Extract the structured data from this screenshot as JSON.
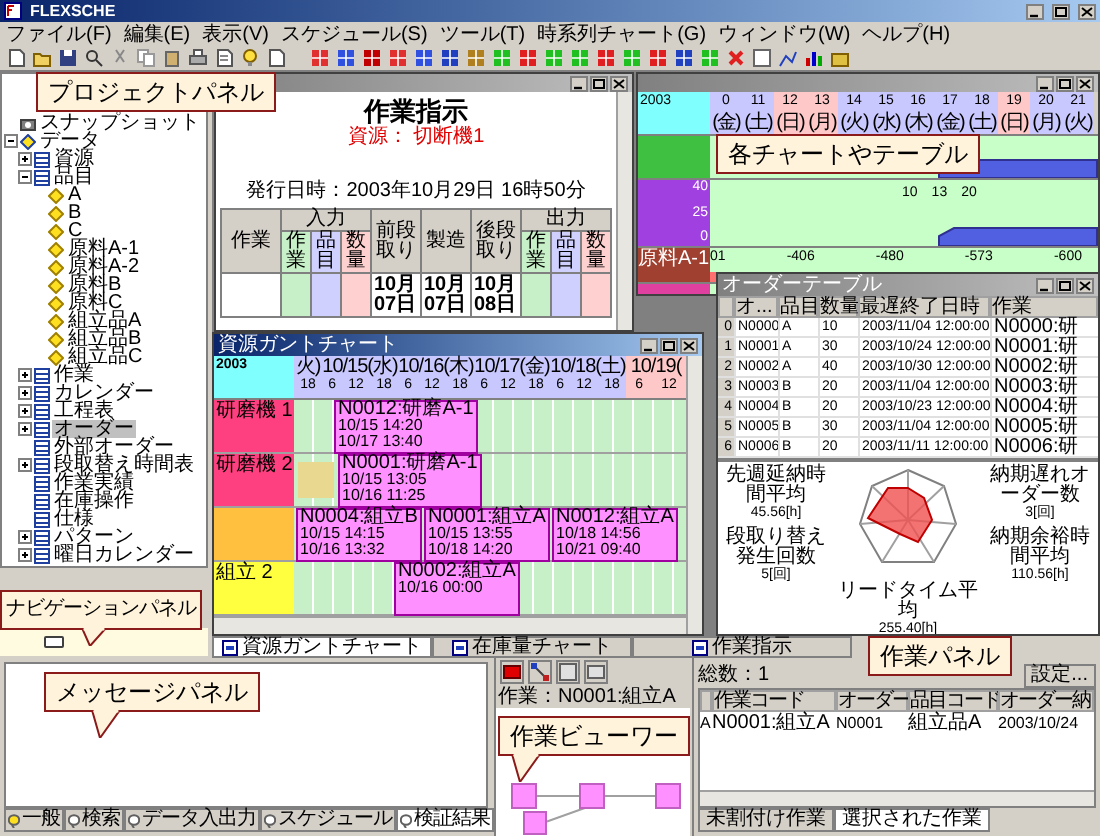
{
  "window": {
    "title": "FLEXSCHE"
  },
  "menu": [
    "ファイル(F)",
    "編集(E)",
    "表示(V)",
    "スケジュール(S)",
    "ツール(T)",
    "時系列チャート(G)",
    "ウィンドウ(W)",
    "ヘルプ(H)"
  ],
  "project_tree": [
    {
      "label": "スナップショット",
      "kind": "snapshot",
      "selected": false
    },
    {
      "label": "データ",
      "kind": "folder",
      "expanded": true,
      "selected": false,
      "children": [
        {
          "label": "資源",
          "kind": "table",
          "expanded": false,
          "selected": false
        },
        {
          "label": "品目",
          "kind": "table",
          "expanded": true,
          "selected": false,
          "children": [
            {
              "label": "A",
              "kind": "item",
              "selected": false
            },
            {
              "label": "B",
              "kind": "item",
              "selected": false
            },
            {
              "label": "C",
              "kind": "item",
              "selected": false
            },
            {
              "label": "原料A-1",
              "kind": "item",
              "selected": false
            },
            {
              "label": "原料A-2",
              "kind": "item",
              "selected": false
            },
            {
              "label": "原料B",
              "kind": "item",
              "selected": false
            },
            {
              "label": "原料C",
              "kind": "item",
              "selected": false
            },
            {
              "label": "組立品A",
              "kind": "item",
              "selected": false
            },
            {
              "label": "組立品B",
              "kind": "item",
              "selected": false
            },
            {
              "label": "組立品C",
              "kind": "item",
              "selected": false
            }
          ]
        },
        {
          "label": "作業",
          "kind": "table",
          "expanded": false,
          "selected": false
        },
        {
          "label": "カレンダー",
          "kind": "table",
          "expanded": false,
          "selected": false
        },
        {
          "label": "工程表",
          "kind": "table",
          "expanded": false,
          "selected": false
        },
        {
          "label": "オーダー",
          "kind": "table",
          "expanded": false,
          "selected": true
        },
        {
          "label": "外部オーダー",
          "kind": "table",
          "selected": false
        },
        {
          "label": "段取替え時間表",
          "kind": "table",
          "expanded": false,
          "selected": false
        },
        {
          "label": "作業実績",
          "kind": "table",
          "selected": false
        },
        {
          "label": "在庫操作",
          "kind": "table",
          "selected": false
        },
        {
          "label": "仕様",
          "kind": "table",
          "selected": false
        },
        {
          "label": "パターン",
          "kind": "table",
          "expanded": false,
          "selected": false
        },
        {
          "label": "曜日カレンダー",
          "kind": "table",
          "expanded": false,
          "selected": false
        }
      ]
    }
  ],
  "callouts": [
    {
      "text": "プロジェクトパネル"
    },
    {
      "text": "各チャートやテーブル"
    },
    {
      "text": "ナビゲーションパネル"
    },
    {
      "text": "メッセージパネル"
    },
    {
      "text": "作業ビューワー"
    },
    {
      "text": "作業パネル"
    }
  ],
  "work_instruction": {
    "heading": "作業指示",
    "resource": "資源： 切断機1",
    "issued": "発行日時：2003年10月29日 16時50分",
    "columns": [
      {
        "label": "作業"
      },
      {
        "label": "入力",
        "sub": [
          {
            "label": "作業",
            "color": "#c8f0c8"
          },
          {
            "label": "品目",
            "color": "#d0d0ff"
          },
          {
            "label": "数量",
            "color": "#ffd0d0"
          }
        ]
      },
      {
        "label": "前段取り"
      },
      {
        "label": "製造"
      },
      {
        "label": "後段取り"
      },
      {
        "label": "出力",
        "sub": [
          {
            "label": "作業",
            "color": "#c8f0c8"
          },
          {
            "label": "品目",
            "color": "#d0d0ff"
          },
          {
            "label": "数量",
            "color": "#ffd0d0"
          }
        ]
      }
    ],
    "dates": [
      "10月07日",
      "10月07日",
      "10月08日"
    ]
  },
  "inventory_chart": {
    "year": "2003",
    "dates": [
      {
        "day": "0",
        "weekday": "(金)",
        "color": "#c8c8ff"
      },
      {
        "day": "11",
        "weekday": "(土)",
        "color": "#c8c8ff"
      },
      {
        "day": "12",
        "weekday": "(日)",
        "color": "#ffc8c8"
      },
      {
        "day": "13",
        "weekday": "(月)",
        "color": "#ffc8c8"
      },
      {
        "day": "14",
        "weekday": "(火)",
        "color": "#c8c8ff"
      },
      {
        "day": "15",
        "weekday": "(水)",
        "color": "#c8c8ff"
      },
      {
        "day": "16",
        "weekday": "(木)",
        "color": "#c8c8ff"
      },
      {
        "day": "17",
        "weekday": "(金)",
        "color": "#c8c8ff"
      },
      {
        "day": "18",
        "weekday": "(土)",
        "color": "#c8c8ff"
      },
      {
        "day": "19",
        "weekday": "(日)",
        "color": "#ffc8c8"
      },
      {
        "day": "20",
        "weekday": "(月)",
        "color": "#c8c8ff"
      },
      {
        "day": "21",
        "weekday": "(火)",
        "color": "#c8c8ff"
      }
    ],
    "rows": [
      {
        "kind": "area",
        "color": "#40c040"
      },
      {
        "kind": "area",
        "color": "#a040e0",
        "axis_labels": [
          "40",
          "25",
          "0"
        ],
        "markers": [
          "10",
          "13",
          "20"
        ]
      },
      {
        "kind": "bar",
        "color": "#a04030",
        "label": "原料A-1",
        "values": [
          "01",
          "-406",
          "-480",
          "-573",
          "-600"
        ]
      },
      {
        "kind": "strip",
        "color": "#e040a0"
      }
    ]
  },
  "order_table": {
    "title": "オーダーテーブル",
    "columns": [
      "オ...",
      "品目",
      "数量",
      "最遅終了日時",
      "作業"
    ],
    "rows": [
      {
        "index": "0",
        "cells": [
          "N0000",
          "A",
          "10",
          "2003/11/04 12:00:00",
          "N0000:研"
        ]
      },
      {
        "index": "1",
        "cells": [
          "N0001",
          "A",
          "30",
          "2003/10/24 12:00:00",
          "N0001:研"
        ]
      },
      {
        "index": "2",
        "cells": [
          "N0002",
          "A",
          "40",
          "2003/10/30 12:00:00",
          "N0002:研"
        ]
      },
      {
        "index": "3",
        "cells": [
          "N0003",
          "B",
          "20",
          "2003/11/04 12:00:00",
          "N0003:研"
        ]
      },
      {
        "index": "4",
        "cells": [
          "N0004",
          "B",
          "20",
          "2003/10/23 12:00:00",
          "N0004:研"
        ]
      },
      {
        "index": "5",
        "cells": [
          "N0005",
          "B",
          "30",
          "2003/11/04 12:00:00",
          "N0005:研"
        ]
      },
      {
        "index": "6",
        "cells": [
          "N0006",
          "B",
          "20",
          "2003/11/11 12:00:00",
          "N0006:研"
        ]
      }
    ]
  },
  "performance_radar": {
    "metrics": [
      {
        "label": "先週延納時間平均",
        "value": "45.56[h]"
      },
      {
        "label": "納期遅れオーダー数",
        "value": "3[回]"
      },
      {
        "label": "段取り替え発生回数",
        "value": "5[回]"
      },
      {
        "label": "納期余裕時間平均",
        "value": "110.56[h]"
      },
      {
        "label": "リードタイム平均",
        "value": "255.40[h]"
      }
    ]
  },
  "gantt": {
    "title": "資源ガントチャート",
    "year": "2003",
    "days": [
      {
        "label": "火)",
        "hours": [
          "18"
        ],
        "color": "#c8c8ff"
      },
      {
        "label": "10/15(水)",
        "hours": [
          "6",
          "12",
          "18"
        ],
        "color": "#c8c8ff"
      },
      {
        "label": "10/16(木)",
        "hours": [
          "6",
          "12",
          "18"
        ],
        "color": "#c8c8ff"
      },
      {
        "label": "10/17(金)",
        "hours": [
          "6",
          "12",
          "18"
        ],
        "color": "#c8c8ff"
      },
      {
        "label": "10/18(土)",
        "hours": [
          "6",
          "12",
          "18"
        ],
        "color": "#c8c8ff"
      },
      {
        "label": "10/19(",
        "hours": [
          "6",
          "12"
        ],
        "color": "#ffc8c8"
      }
    ],
    "rows": [
      {
        "label": "研磨機 1",
        "color": "#ff4080",
        "bars": [
          {
            "lines": [
              "N0012:研磨A-1",
              "10/15 14:20",
              "10/17 13:40"
            ]
          }
        ]
      },
      {
        "label": "研磨機 2",
        "color": "#ff4080",
        "bars": [
          {
            "lines": [
              "N0001:研磨A-1",
              "10/15 13:05",
              "10/16 11:25"
            ]
          }
        ]
      },
      {
        "color": "#ffc040",
        "bars": [
          {
            "lines": [
              "N0004:組立B",
              "10/15 14:15",
              "10/16 13:32"
            ]
          },
          {
            "lines": [
              "N0001:組立A",
              "10/15 13:55",
              "10/18 14:20"
            ]
          },
          {
            "lines": [
              "N0012:組立A",
              "10/18 14:56",
              "10/21 09:40"
            ]
          }
        ]
      },
      {
        "label": "組立 2",
        "color": "#ffff40",
        "bars": [
          {
            "lines": [
              "N0002:組立A",
              "10/16 00:00"
            ]
          }
        ]
      }
    ]
  },
  "document_tabs": [
    {
      "label": "資源ガントチャート",
      "selected": true
    },
    {
      "label": "在庫量チャート",
      "selected": false
    },
    {
      "label": "作業指示",
      "selected": false
    }
  ],
  "message_panel": {
    "tabs": [
      {
        "label": "一般",
        "selected": false
      },
      {
        "label": "検索",
        "selected": false
      },
      {
        "label": "データ入出力",
        "selected": false
      },
      {
        "label": "スケジュール",
        "selected": false
      },
      {
        "label": "検証結果",
        "selected": true
      }
    ]
  },
  "work_viewer": {
    "caption": "作業：N0001:組立A"
  },
  "work_panel": {
    "count": "総数：1",
    "settings_button": "設定...",
    "columns": [
      "",
      "作業コード",
      "オーダー",
      "品目コード",
      "オーダー納"
    ],
    "rows": [
      [
        "A",
        "N0001:組立A",
        "N0001",
        "組立品A",
        "2003/10/24"
      ]
    ],
    "tabs": [
      {
        "label": "未割付け作業",
        "selected": false
      },
      {
        "label": "選択された作業",
        "selected": true
      }
    ]
  }
}
